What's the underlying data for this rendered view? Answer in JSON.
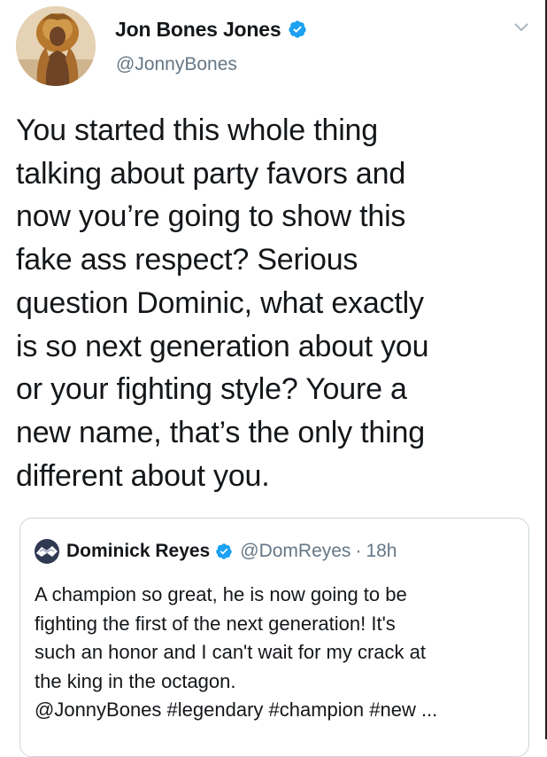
{
  "tweet": {
    "author": {
      "display_name": "Jon Bones Jones",
      "handle": "@JonnyBones",
      "verified": true,
      "avatar_icon": "lion-headdress-avatar"
    },
    "text": "You started this whole thing\ntalking about party favors and\nnow you’re going to show this\nfake ass respect? Serious\nquestion Dominic, what exactly\nis so next generation about you\nor your fighting style? Youre a\nnew name, that’s the only thing\ndifferent about you.",
    "menu_icon": "chevron-down-icon"
  },
  "quoted_tweet": {
    "author": {
      "display_name": "Dominick Reyes",
      "handle": "@DomReyes",
      "verified": true
    },
    "separator": "·",
    "timestamp": "18h",
    "text": "A champion so great, he is now going to be\nfighting the first of the next generation! It's\nsuch an honor and I can't wait for my crack at\nthe king in the octagon.\n@JonnyBones #legendary #champion #new ..."
  },
  "colors": {
    "text_primary": "#14171a",
    "text_secondary": "#657786",
    "verified_blue": "#1da1f2",
    "border": "#ccd6dd"
  }
}
